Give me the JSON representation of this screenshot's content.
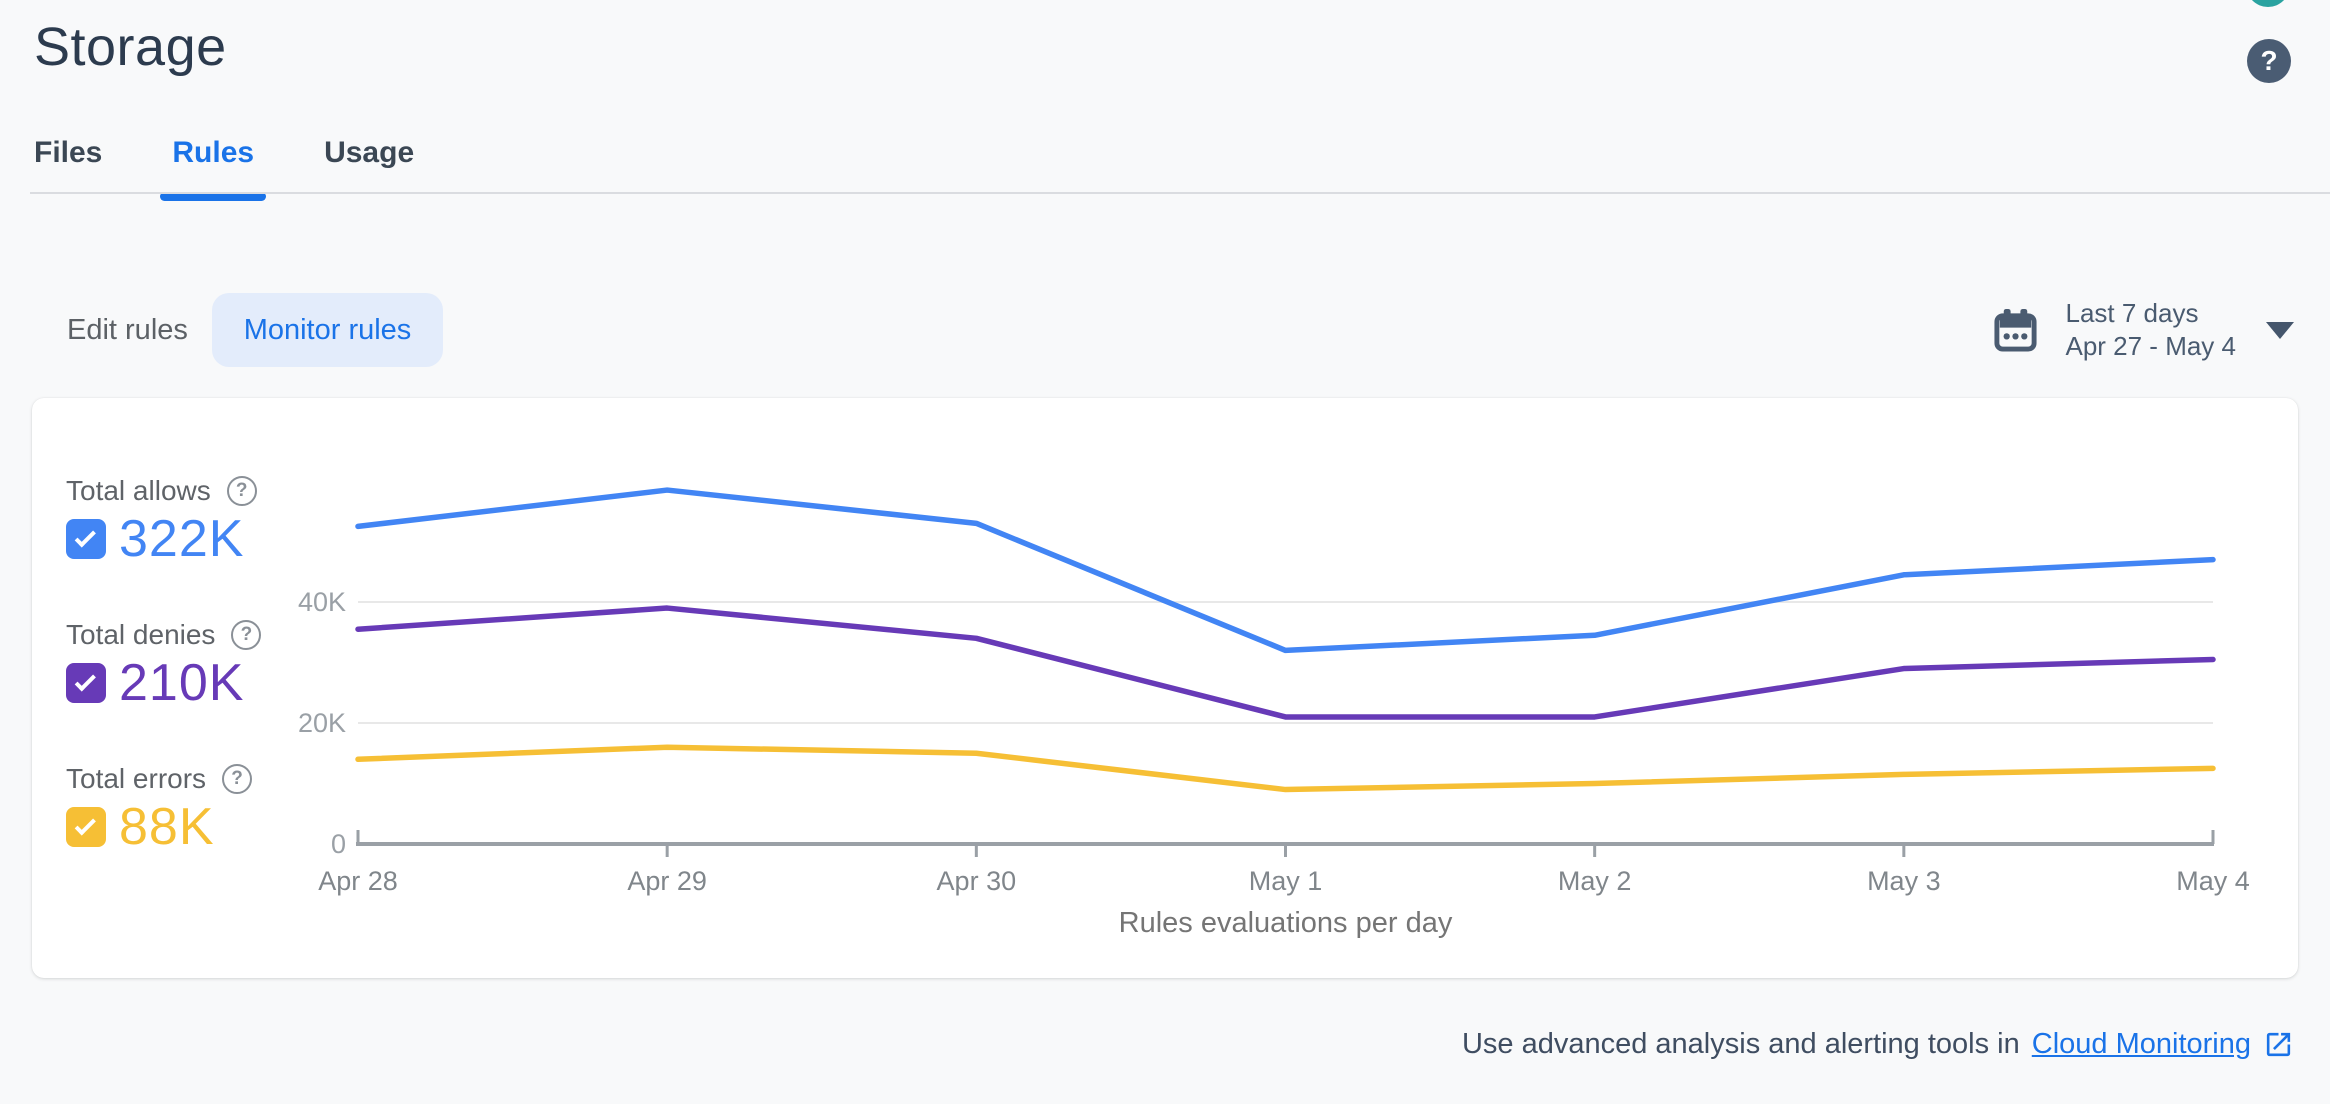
{
  "header": {
    "title": "Storage",
    "help_label": "?"
  },
  "tabs": [
    {
      "label": "Files",
      "active": false
    },
    {
      "label": "Rules",
      "active": true
    },
    {
      "label": "Usage",
      "active": false
    }
  ],
  "controls": {
    "edit_rules_label": "Edit rules",
    "monitor_rules_label": "Monitor rules",
    "date_range": {
      "line1": "Last 7 days",
      "line2": "Apr 27 - May 4"
    }
  },
  "legend": [
    {
      "label": "Total allows",
      "value": "322K",
      "color": "#4285F4",
      "checked": true
    },
    {
      "label": "Total denies",
      "value": "210K",
      "color": "#673AB7",
      "checked": true
    },
    {
      "label": "Total errors",
      "value": "88K",
      "color": "#F6BF35",
      "checked": true
    }
  ],
  "chart_data": {
    "type": "line",
    "title": "Rules evaluations per day",
    "x": [
      "Apr 28",
      "Apr 29",
      "Apr 30",
      "May 1",
      "May 2",
      "May 3",
      "May 4"
    ],
    "series": [
      {
        "name": "Total allows",
        "color": "#4285F4",
        "values": [
          52500,
          58500,
          53000,
          32000,
          34500,
          44500,
          47000
        ]
      },
      {
        "name": "Total denies",
        "color": "#673AB7",
        "values": [
          35500,
          39000,
          34000,
          21000,
          21000,
          29000,
          30500
        ]
      },
      {
        "name": "Total errors",
        "color": "#F6BF35",
        "values": [
          14000,
          16000,
          15000,
          9000,
          10000,
          11500,
          12500
        ]
      }
    ],
    "yticks": [
      {
        "value": 0,
        "label": "0"
      },
      {
        "value": 20000,
        "label": "20K"
      },
      {
        "value": 40000,
        "label": "40K"
      }
    ],
    "ylim": [
      0,
      73000
    ],
    "grid": true,
    "legend_position": "left"
  },
  "footer": {
    "prefix": "Use advanced analysis and alerting tools in ",
    "link_label": "Cloud Monitoring"
  }
}
